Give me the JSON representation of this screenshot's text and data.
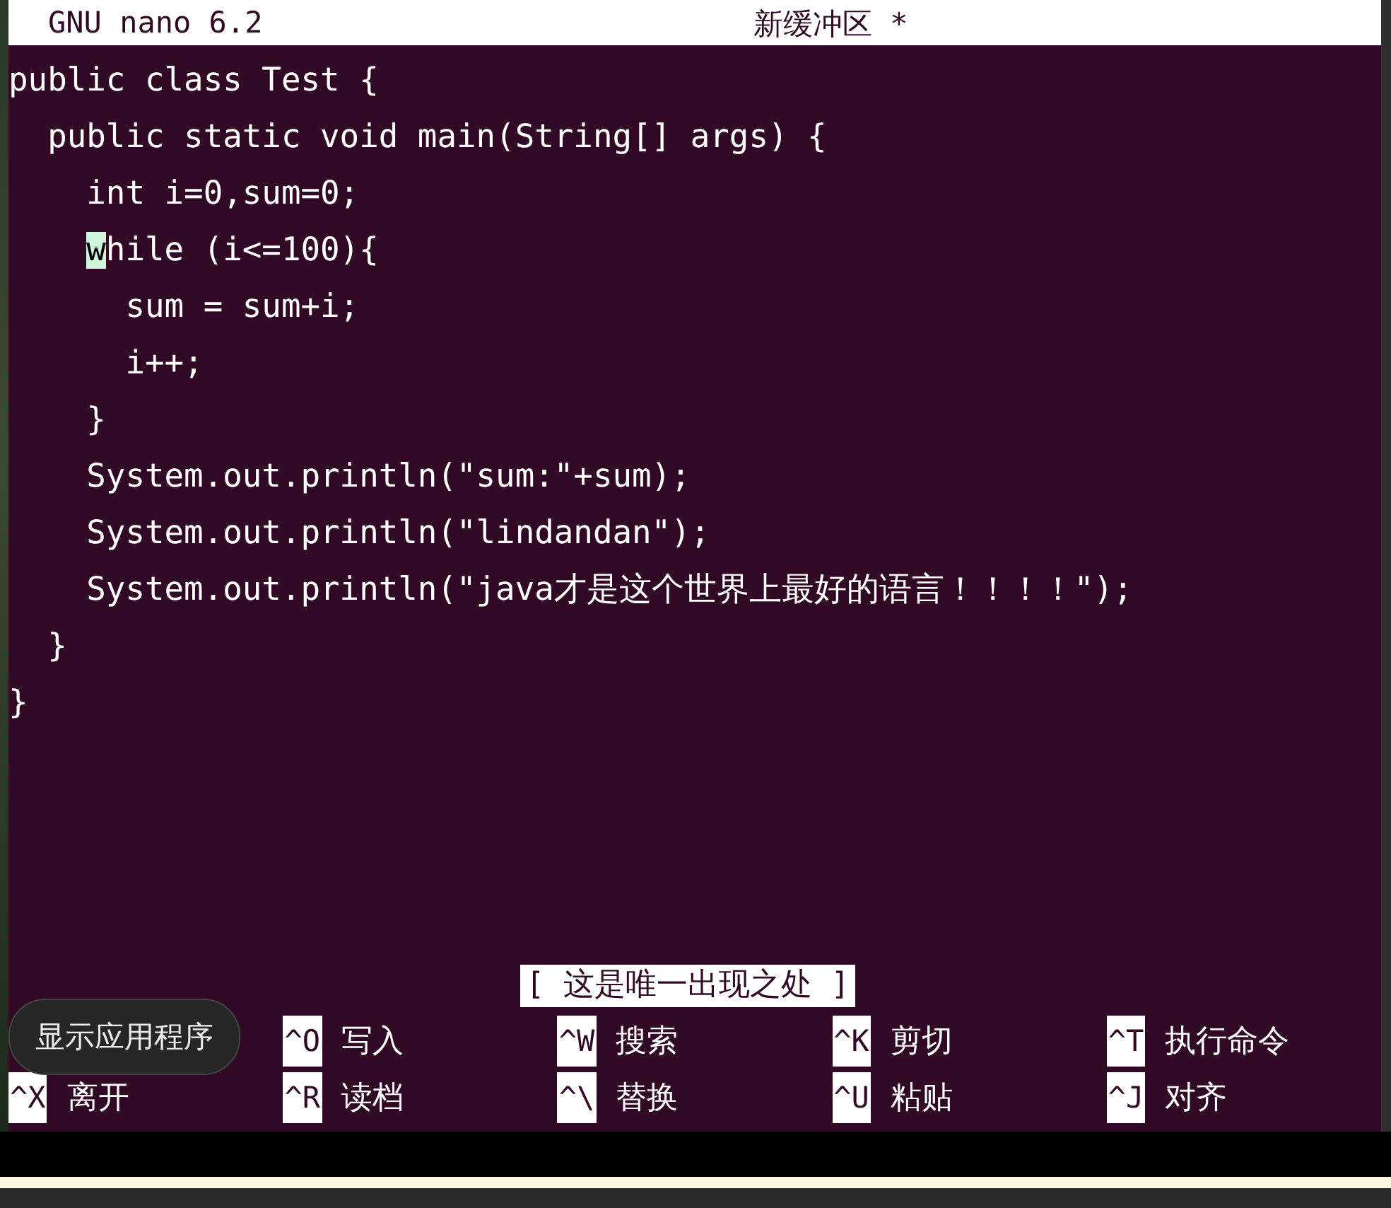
{
  "title_bar": {
    "app": "GNU nano 6.2",
    "buffer": "新缓冲区 *"
  },
  "lines": [
    {
      "text": "public class Test {",
      "cursor": false
    },
    {
      "text": "  public static void main(String[] args) {",
      "cursor": false
    },
    {
      "text": "    int i=0,sum=0;",
      "cursor": false
    },
    {
      "text": "    while (i<=100){",
      "cursor": true
    },
    {
      "text": "      sum = sum+i;",
      "cursor": false
    },
    {
      "text": "      i++;",
      "cursor": false
    },
    {
      "text": "    }",
      "cursor": false
    },
    {
      "text": "    System.out.println(\"sum:\"+sum);",
      "cursor": false
    },
    {
      "text": "    System.out.println(\"lindandan\");",
      "cursor": false
    },
    {
      "text": "    System.out.println(\"java才是这个世界上最好的语言！！！！\");",
      "cursor": false
    },
    {
      "text": "  }",
      "cursor": false
    },
    {
      "text": "}",
      "cursor": false
    }
  ],
  "status_message": "[ 这是唯一出现之处 ]",
  "shortcuts": [
    [
      {
        "key": "^X",
        "label": "离开"
      }
    ],
    [
      {
        "key": "^O",
        "label": "写入"
      },
      {
        "key": "^R",
        "label": "读档"
      }
    ],
    [
      {
        "key": "^W",
        "label": "搜索"
      },
      {
        "key": "^\\",
        "label": "替换"
      }
    ],
    [
      {
        "key": "^K",
        "label": "剪切"
      },
      {
        "key": "^U",
        "label": "粘贴"
      }
    ],
    [
      {
        "key": "^T",
        "label": "执行命令"
      },
      {
        "key": "^J",
        "label": "对齐"
      }
    ]
  ],
  "tooltip": "显示应用程序"
}
